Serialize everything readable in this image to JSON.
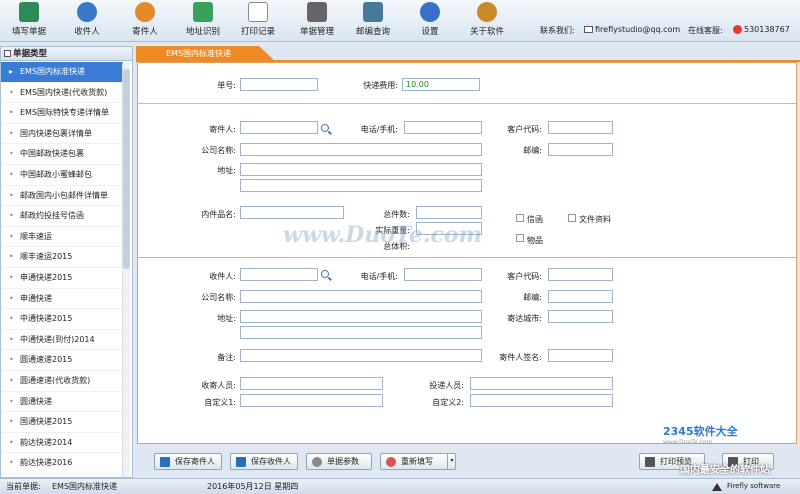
{
  "toolbar": {
    "buttons": [
      {
        "label": "填写单据",
        "icon": "form-fill-icon",
        "color": "#2e8b57"
      },
      {
        "label": "收件人",
        "icon": "recipients-icon",
        "color": "#3a78c8"
      },
      {
        "label": "寄件人",
        "icon": "sender-icon",
        "color": "#e08a2a"
      },
      {
        "label": "地址识别",
        "icon": "address-recognize-icon",
        "color": "#3aa05a"
      },
      {
        "label": "打印记录",
        "icon": "print-record-icon",
        "color": "#a0a0a0"
      },
      {
        "label": "单据管理",
        "icon": "document-manage-icon",
        "color": "#666666"
      },
      {
        "label": "邮编查询",
        "icon": "postcode-query-icon",
        "color": "#4a7a9a"
      },
      {
        "label": "设置",
        "icon": "settings-icon",
        "color": "#3a6ec8"
      },
      {
        "label": "关于软件",
        "icon": "about-icon",
        "color": "#c88a2a"
      }
    ],
    "contact_label": "联系我们:",
    "contact_email": "fireflystudio@qq.com",
    "support_label": "在线客服:",
    "support_qq": "530138767"
  },
  "sidebar": {
    "header": "单据类型",
    "items": [
      "EMS国内标准快递",
      "EMS国内快递(代收货款)",
      "EMS国际特快专递详情单",
      "国内快递包裹详情单",
      "中国邮政快递包裹",
      "中国邮政小蜜蜂邮包",
      "邮政国内小包邮件详情单",
      "邮政约投挂号信函",
      "顺丰速运",
      "顺丰速运2015",
      "申通快递2015",
      "申通快递",
      "中通快递2015",
      "中通快递(到付)2014",
      "圆通速递2015",
      "圆通速递(代收货款)",
      "圆通快递",
      "国通快递2015",
      "韵达快递2014",
      "韵达快递2016"
    ],
    "active_index": 0
  },
  "tab": {
    "label": "EMS国内标准快递"
  },
  "form": {
    "order_no_label": "单号:",
    "order_no_value": "",
    "fee_label": "快递费用:",
    "fee_value": "10.00",
    "sender_label": "寄件人:",
    "phone_label": "电话/手机:",
    "customer_code_label": "客户代码:",
    "company_label": "公司名称:",
    "postcode_label": "邮编:",
    "address_label": "地址:",
    "item_name_label": "内件品名:",
    "total_count_label": "总件数:",
    "actual_weight_label": "实际重量:",
    "total_volume_label": "总体积:",
    "letter_label": "信函",
    "file_label": "文件资料",
    "goods_label": "物品",
    "recipient_label": "收件人:",
    "phone2_label": "电话/手机:",
    "customer_code2_label": "客户代码:",
    "company2_label": "公司名称:",
    "postcode2_label": "邮编:",
    "address2_label": "地址:",
    "dest_city_label": "寄达城市:",
    "remark_label": "备注:",
    "sender_sign_label": "寄件人签名:",
    "receiver_staff_label": "收寄人员:",
    "delivery_staff_label": "投递人员:",
    "custom1_label": "自定义1:",
    "custom2_label": "自定义2:"
  },
  "buttons": {
    "save_sender": "保存寄件人",
    "save_recipient": "保存收件人",
    "doc_params": "单据参数",
    "rewrite": "重新填写",
    "print_preview": "打印预览",
    "print": "打印"
  },
  "status": {
    "current_label": "当前单据:",
    "current_value": "EMS国内标准快递",
    "date": "2016年05月12日  星期四",
    "studio": "Firefly software studio"
  },
  "watermark": "www.DuoTe.com",
  "corner_logo": "2345软件大全",
  "corner_logo_url": "www.DuoTe.com",
  "corner_logo2": "国内最安全的软件站"
}
